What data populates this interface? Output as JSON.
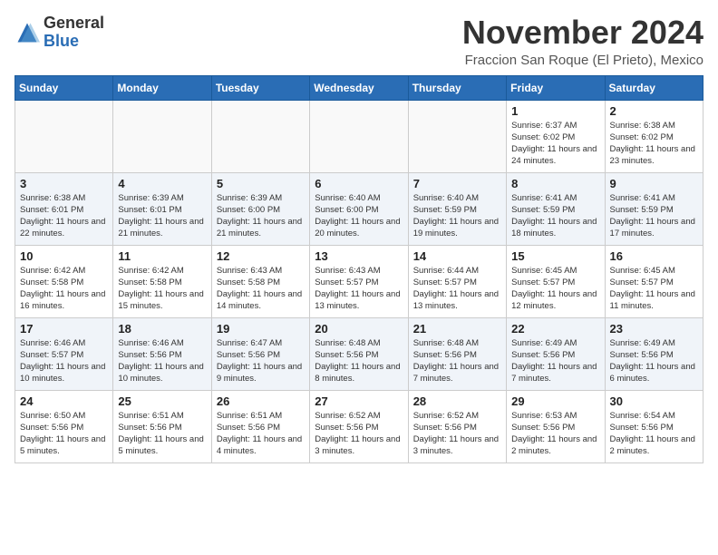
{
  "logo": {
    "general": "General",
    "blue": "Blue"
  },
  "title": "November 2024",
  "location": "Fraccion San Roque (El Prieto), Mexico",
  "days_of_week": [
    "Sunday",
    "Monday",
    "Tuesday",
    "Wednesday",
    "Thursday",
    "Friday",
    "Saturday"
  ],
  "weeks": [
    [
      {
        "day": "",
        "info": ""
      },
      {
        "day": "",
        "info": ""
      },
      {
        "day": "",
        "info": ""
      },
      {
        "day": "",
        "info": ""
      },
      {
        "day": "",
        "info": ""
      },
      {
        "day": "1",
        "info": "Sunrise: 6:37 AM\nSunset: 6:02 PM\nDaylight: 11 hours and 24 minutes."
      },
      {
        "day": "2",
        "info": "Sunrise: 6:38 AM\nSunset: 6:02 PM\nDaylight: 11 hours and 23 minutes."
      }
    ],
    [
      {
        "day": "3",
        "info": "Sunrise: 6:38 AM\nSunset: 6:01 PM\nDaylight: 11 hours and 22 minutes."
      },
      {
        "day": "4",
        "info": "Sunrise: 6:39 AM\nSunset: 6:01 PM\nDaylight: 11 hours and 21 minutes."
      },
      {
        "day": "5",
        "info": "Sunrise: 6:39 AM\nSunset: 6:00 PM\nDaylight: 11 hours and 21 minutes."
      },
      {
        "day": "6",
        "info": "Sunrise: 6:40 AM\nSunset: 6:00 PM\nDaylight: 11 hours and 20 minutes."
      },
      {
        "day": "7",
        "info": "Sunrise: 6:40 AM\nSunset: 5:59 PM\nDaylight: 11 hours and 19 minutes."
      },
      {
        "day": "8",
        "info": "Sunrise: 6:41 AM\nSunset: 5:59 PM\nDaylight: 11 hours and 18 minutes."
      },
      {
        "day": "9",
        "info": "Sunrise: 6:41 AM\nSunset: 5:59 PM\nDaylight: 11 hours and 17 minutes."
      }
    ],
    [
      {
        "day": "10",
        "info": "Sunrise: 6:42 AM\nSunset: 5:58 PM\nDaylight: 11 hours and 16 minutes."
      },
      {
        "day": "11",
        "info": "Sunrise: 6:42 AM\nSunset: 5:58 PM\nDaylight: 11 hours and 15 minutes."
      },
      {
        "day": "12",
        "info": "Sunrise: 6:43 AM\nSunset: 5:58 PM\nDaylight: 11 hours and 14 minutes."
      },
      {
        "day": "13",
        "info": "Sunrise: 6:43 AM\nSunset: 5:57 PM\nDaylight: 11 hours and 13 minutes."
      },
      {
        "day": "14",
        "info": "Sunrise: 6:44 AM\nSunset: 5:57 PM\nDaylight: 11 hours and 13 minutes."
      },
      {
        "day": "15",
        "info": "Sunrise: 6:45 AM\nSunset: 5:57 PM\nDaylight: 11 hours and 12 minutes."
      },
      {
        "day": "16",
        "info": "Sunrise: 6:45 AM\nSunset: 5:57 PM\nDaylight: 11 hours and 11 minutes."
      }
    ],
    [
      {
        "day": "17",
        "info": "Sunrise: 6:46 AM\nSunset: 5:57 PM\nDaylight: 11 hours and 10 minutes."
      },
      {
        "day": "18",
        "info": "Sunrise: 6:46 AM\nSunset: 5:56 PM\nDaylight: 11 hours and 10 minutes."
      },
      {
        "day": "19",
        "info": "Sunrise: 6:47 AM\nSunset: 5:56 PM\nDaylight: 11 hours and 9 minutes."
      },
      {
        "day": "20",
        "info": "Sunrise: 6:48 AM\nSunset: 5:56 PM\nDaylight: 11 hours and 8 minutes."
      },
      {
        "day": "21",
        "info": "Sunrise: 6:48 AM\nSunset: 5:56 PM\nDaylight: 11 hours and 7 minutes."
      },
      {
        "day": "22",
        "info": "Sunrise: 6:49 AM\nSunset: 5:56 PM\nDaylight: 11 hours and 7 minutes."
      },
      {
        "day": "23",
        "info": "Sunrise: 6:49 AM\nSunset: 5:56 PM\nDaylight: 11 hours and 6 minutes."
      }
    ],
    [
      {
        "day": "24",
        "info": "Sunrise: 6:50 AM\nSunset: 5:56 PM\nDaylight: 11 hours and 5 minutes."
      },
      {
        "day": "25",
        "info": "Sunrise: 6:51 AM\nSunset: 5:56 PM\nDaylight: 11 hours and 5 minutes."
      },
      {
        "day": "26",
        "info": "Sunrise: 6:51 AM\nSunset: 5:56 PM\nDaylight: 11 hours and 4 minutes."
      },
      {
        "day": "27",
        "info": "Sunrise: 6:52 AM\nSunset: 5:56 PM\nDaylight: 11 hours and 3 minutes."
      },
      {
        "day": "28",
        "info": "Sunrise: 6:52 AM\nSunset: 5:56 PM\nDaylight: 11 hours and 3 minutes."
      },
      {
        "day": "29",
        "info": "Sunrise: 6:53 AM\nSunset: 5:56 PM\nDaylight: 11 hours and 2 minutes."
      },
      {
        "day": "30",
        "info": "Sunrise: 6:54 AM\nSunset: 5:56 PM\nDaylight: 11 hours and 2 minutes."
      }
    ]
  ]
}
